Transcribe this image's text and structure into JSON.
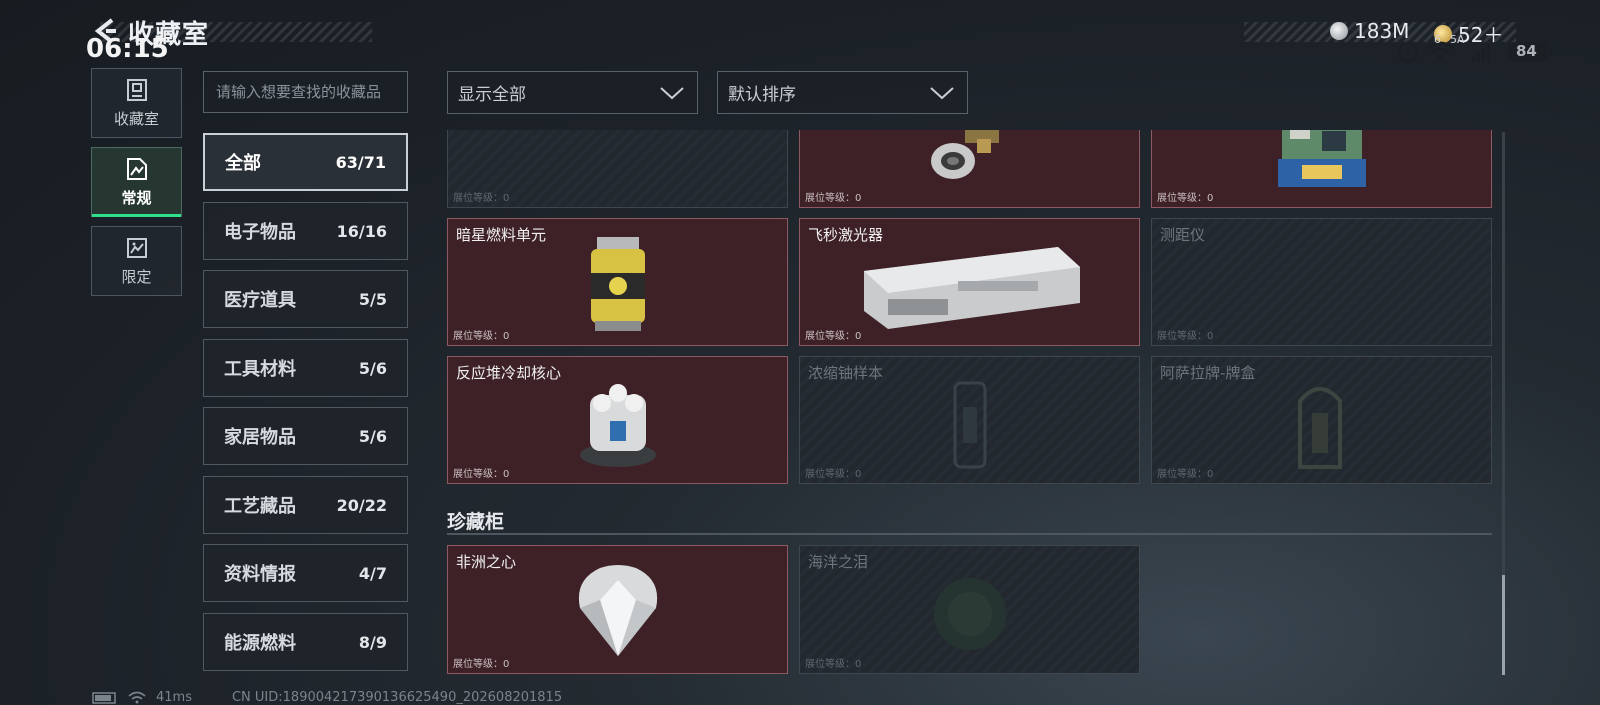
{
  "header": {
    "title": "收藏室",
    "clock": "06:15",
    "currency_silver": "183M",
    "currency_gold": "52＋",
    "battery": "84",
    "network": "5A",
    "wifi_band": "6"
  },
  "side_tabs": [
    {
      "label": "收藏室",
      "icon": "collection-room-icon"
    },
    {
      "label": "常规",
      "icon": "regular-icon",
      "active": true
    },
    {
      "label": "限定",
      "icon": "limited-icon"
    }
  ],
  "search": {
    "placeholder": "请输入想要查找的收藏品"
  },
  "categories": [
    {
      "name": "全部",
      "count": "63/71",
      "active": true
    },
    {
      "name": "电子物品",
      "count": "16/16"
    },
    {
      "name": "医疗道具",
      "count": "5/5"
    },
    {
      "name": "工具材料",
      "count": "5/6"
    },
    {
      "name": "家居物品",
      "count": "5/6"
    },
    {
      "name": "工艺藏品",
      "count": "20/22"
    },
    {
      "name": "资料情报",
      "count": "4/7"
    },
    {
      "name": "能源燃料",
      "count": "8/9"
    }
  ],
  "filters": {
    "show": "显示全部",
    "sort": "默认排序"
  },
  "level_label": "展位等级：0",
  "grid": {
    "row0": [
      {
        "title": "",
        "owned": false
      },
      {
        "title": "",
        "owned": true
      },
      {
        "title": "",
        "owned": true
      }
    ],
    "row1": [
      {
        "title": "暗星燃料单元",
        "owned": true
      },
      {
        "title": "飞秒激光器",
        "owned": true
      },
      {
        "title": "测距仪",
        "owned": false
      }
    ],
    "row2": [
      {
        "title": "反应堆冷却核心",
        "owned": true
      },
      {
        "title": "浓缩铀样本",
        "owned": false
      },
      {
        "title": "阿萨拉牌-牌盒",
        "owned": false
      }
    ]
  },
  "section": {
    "title": "珍藏柜"
  },
  "treasure": [
    {
      "title": "非洲之心",
      "owned": true
    },
    {
      "title": "海洋之泪",
      "owned": false
    }
  ],
  "footer": {
    "ping": "41ms",
    "uid": "CN UID:1890042173901366254​90_202608201815"
  }
}
